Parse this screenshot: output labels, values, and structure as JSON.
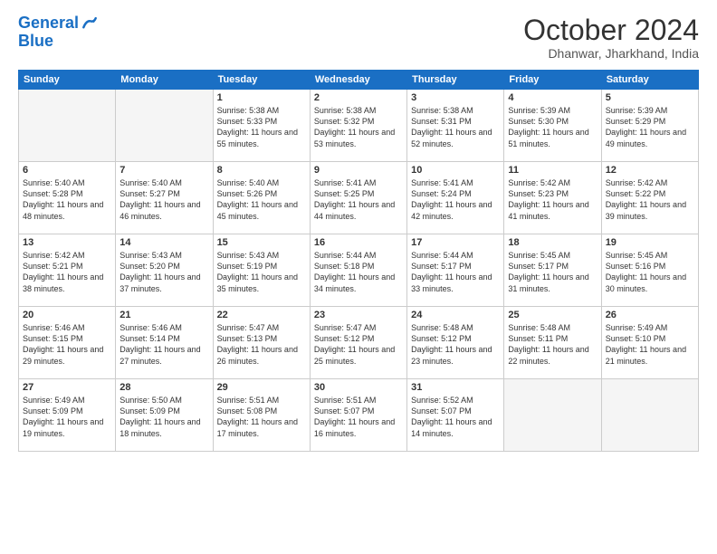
{
  "header": {
    "logo_line1": "General",
    "logo_line2": "Blue",
    "month": "October 2024",
    "location": "Dhanwar, Jharkhand, India"
  },
  "days_of_week": [
    "Sunday",
    "Monday",
    "Tuesday",
    "Wednesday",
    "Thursday",
    "Friday",
    "Saturday"
  ],
  "weeks": [
    [
      {
        "day": "",
        "empty": true
      },
      {
        "day": "",
        "empty": true
      },
      {
        "day": "1",
        "sunrise": "5:38 AM",
        "sunset": "5:33 PM",
        "daylight": "11 hours and 55 minutes."
      },
      {
        "day": "2",
        "sunrise": "5:38 AM",
        "sunset": "5:32 PM",
        "daylight": "11 hours and 53 minutes."
      },
      {
        "day": "3",
        "sunrise": "5:38 AM",
        "sunset": "5:31 PM",
        "daylight": "11 hours and 52 minutes."
      },
      {
        "day": "4",
        "sunrise": "5:39 AM",
        "sunset": "5:30 PM",
        "daylight": "11 hours and 51 minutes."
      },
      {
        "day": "5",
        "sunrise": "5:39 AM",
        "sunset": "5:29 PM",
        "daylight": "11 hours and 49 minutes."
      }
    ],
    [
      {
        "day": "6",
        "sunrise": "5:40 AM",
        "sunset": "5:28 PM",
        "daylight": "11 hours and 48 minutes."
      },
      {
        "day": "7",
        "sunrise": "5:40 AM",
        "sunset": "5:27 PM",
        "daylight": "11 hours and 46 minutes."
      },
      {
        "day": "8",
        "sunrise": "5:40 AM",
        "sunset": "5:26 PM",
        "daylight": "11 hours and 45 minutes."
      },
      {
        "day": "9",
        "sunrise": "5:41 AM",
        "sunset": "5:25 PM",
        "daylight": "11 hours and 44 minutes."
      },
      {
        "day": "10",
        "sunrise": "5:41 AM",
        "sunset": "5:24 PM",
        "daylight": "11 hours and 42 minutes."
      },
      {
        "day": "11",
        "sunrise": "5:42 AM",
        "sunset": "5:23 PM",
        "daylight": "11 hours and 41 minutes."
      },
      {
        "day": "12",
        "sunrise": "5:42 AM",
        "sunset": "5:22 PM",
        "daylight": "11 hours and 39 minutes."
      }
    ],
    [
      {
        "day": "13",
        "sunrise": "5:42 AM",
        "sunset": "5:21 PM",
        "daylight": "11 hours and 38 minutes."
      },
      {
        "day": "14",
        "sunrise": "5:43 AM",
        "sunset": "5:20 PM",
        "daylight": "11 hours and 37 minutes."
      },
      {
        "day": "15",
        "sunrise": "5:43 AM",
        "sunset": "5:19 PM",
        "daylight": "11 hours and 35 minutes."
      },
      {
        "day": "16",
        "sunrise": "5:44 AM",
        "sunset": "5:18 PM",
        "daylight": "11 hours and 34 minutes."
      },
      {
        "day": "17",
        "sunrise": "5:44 AM",
        "sunset": "5:17 PM",
        "daylight": "11 hours and 33 minutes."
      },
      {
        "day": "18",
        "sunrise": "5:45 AM",
        "sunset": "5:17 PM",
        "daylight": "11 hours and 31 minutes."
      },
      {
        "day": "19",
        "sunrise": "5:45 AM",
        "sunset": "5:16 PM",
        "daylight": "11 hours and 30 minutes."
      }
    ],
    [
      {
        "day": "20",
        "sunrise": "5:46 AM",
        "sunset": "5:15 PM",
        "daylight": "11 hours and 29 minutes."
      },
      {
        "day": "21",
        "sunrise": "5:46 AM",
        "sunset": "5:14 PM",
        "daylight": "11 hours and 27 minutes."
      },
      {
        "day": "22",
        "sunrise": "5:47 AM",
        "sunset": "5:13 PM",
        "daylight": "11 hours and 26 minutes."
      },
      {
        "day": "23",
        "sunrise": "5:47 AM",
        "sunset": "5:12 PM",
        "daylight": "11 hours and 25 minutes."
      },
      {
        "day": "24",
        "sunrise": "5:48 AM",
        "sunset": "5:12 PM",
        "daylight": "11 hours and 23 minutes."
      },
      {
        "day": "25",
        "sunrise": "5:48 AM",
        "sunset": "5:11 PM",
        "daylight": "11 hours and 22 minutes."
      },
      {
        "day": "26",
        "sunrise": "5:49 AM",
        "sunset": "5:10 PM",
        "daylight": "11 hours and 21 minutes."
      }
    ],
    [
      {
        "day": "27",
        "sunrise": "5:49 AM",
        "sunset": "5:09 PM",
        "daylight": "11 hours and 19 minutes."
      },
      {
        "day": "28",
        "sunrise": "5:50 AM",
        "sunset": "5:09 PM",
        "daylight": "11 hours and 18 minutes."
      },
      {
        "day": "29",
        "sunrise": "5:51 AM",
        "sunset": "5:08 PM",
        "daylight": "11 hours and 17 minutes."
      },
      {
        "day": "30",
        "sunrise": "5:51 AM",
        "sunset": "5:07 PM",
        "daylight": "11 hours and 16 minutes."
      },
      {
        "day": "31",
        "sunrise": "5:52 AM",
        "sunset": "5:07 PM",
        "daylight": "11 hours and 14 minutes."
      },
      {
        "day": "",
        "empty": true
      },
      {
        "day": "",
        "empty": true
      }
    ]
  ]
}
